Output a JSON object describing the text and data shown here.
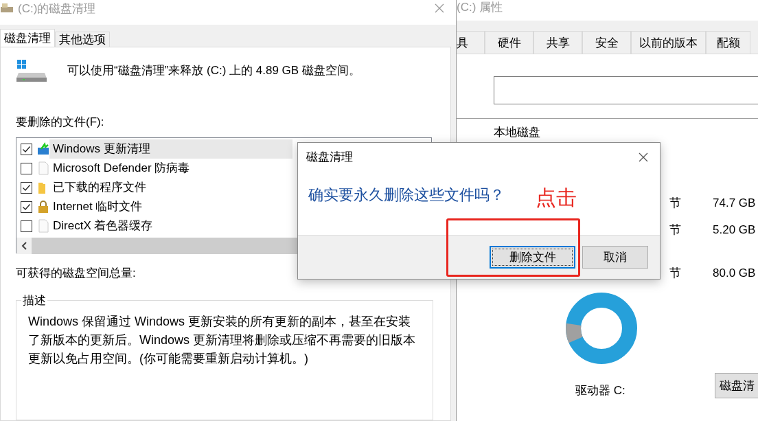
{
  "cleanup_window": {
    "title": "(C:)的磁盘清理",
    "tabs": [
      {
        "label": "磁盘清理",
        "selected": true
      },
      {
        "label": "其他选项",
        "selected": false
      }
    ],
    "summary": "可以使用“磁盘清理”来释放 (C:) 上的 4.89 GB 磁盘空间。",
    "files_label": "要删除的文件(F):",
    "files": [
      {
        "label": "Windows 更新清理",
        "checked": true,
        "selected": true,
        "kind": "update"
      },
      {
        "label": "Microsoft Defender 防病毒",
        "checked": false,
        "selected": false,
        "kind": "file"
      },
      {
        "label": "已下载的程序文件",
        "checked": true,
        "selected": false,
        "kind": "folder"
      },
      {
        "label": "Internet 临时文件",
        "checked": true,
        "selected": false,
        "kind": "lock"
      },
      {
        "label": "DirectX 着色器缓存",
        "checked": false,
        "selected": false,
        "kind": "file"
      }
    ],
    "total_label": "可获得的磁盘空间总量:",
    "description": {
      "title": "描述",
      "text": "Windows 保留通过 Windows 更新安装的所有更新的副本，甚至在安装了新版本的更新后。Windows 更新清理将删除或压缩不再需要的旧版本更新以免占用空间。(你可能需要重新启动计算机。)"
    }
  },
  "properties_window": {
    "title": "(C:) 属性",
    "tabs": [
      {
        "label": "具",
        "selected": false
      },
      {
        "label": "硬件",
        "selected": false
      },
      {
        "label": "共享",
        "selected": false
      },
      {
        "label": "安全",
        "selected": false
      },
      {
        "label": "以前的版本",
        "selected": false
      },
      {
        "label": "配额",
        "selected": false
      }
    ],
    "type_label": "本地磁盘",
    "rows": [
      {
        "label": "节",
        "value": "74.7 GB"
      },
      {
        "label": "节",
        "value": "5.20 GB"
      },
      {
        "label": "节",
        "value": "80.0 GB"
      }
    ],
    "drive_label": "驱动器 C:",
    "cleanup_button": "磁盘清"
  },
  "dialog": {
    "title": "磁盘清理",
    "message": "确实要永久删除这些文件吗？",
    "buttons": [
      {
        "label": "删除文件",
        "default": true
      },
      {
        "label": "取消",
        "default": false
      }
    ]
  },
  "annotation": {
    "text": "点击"
  }
}
